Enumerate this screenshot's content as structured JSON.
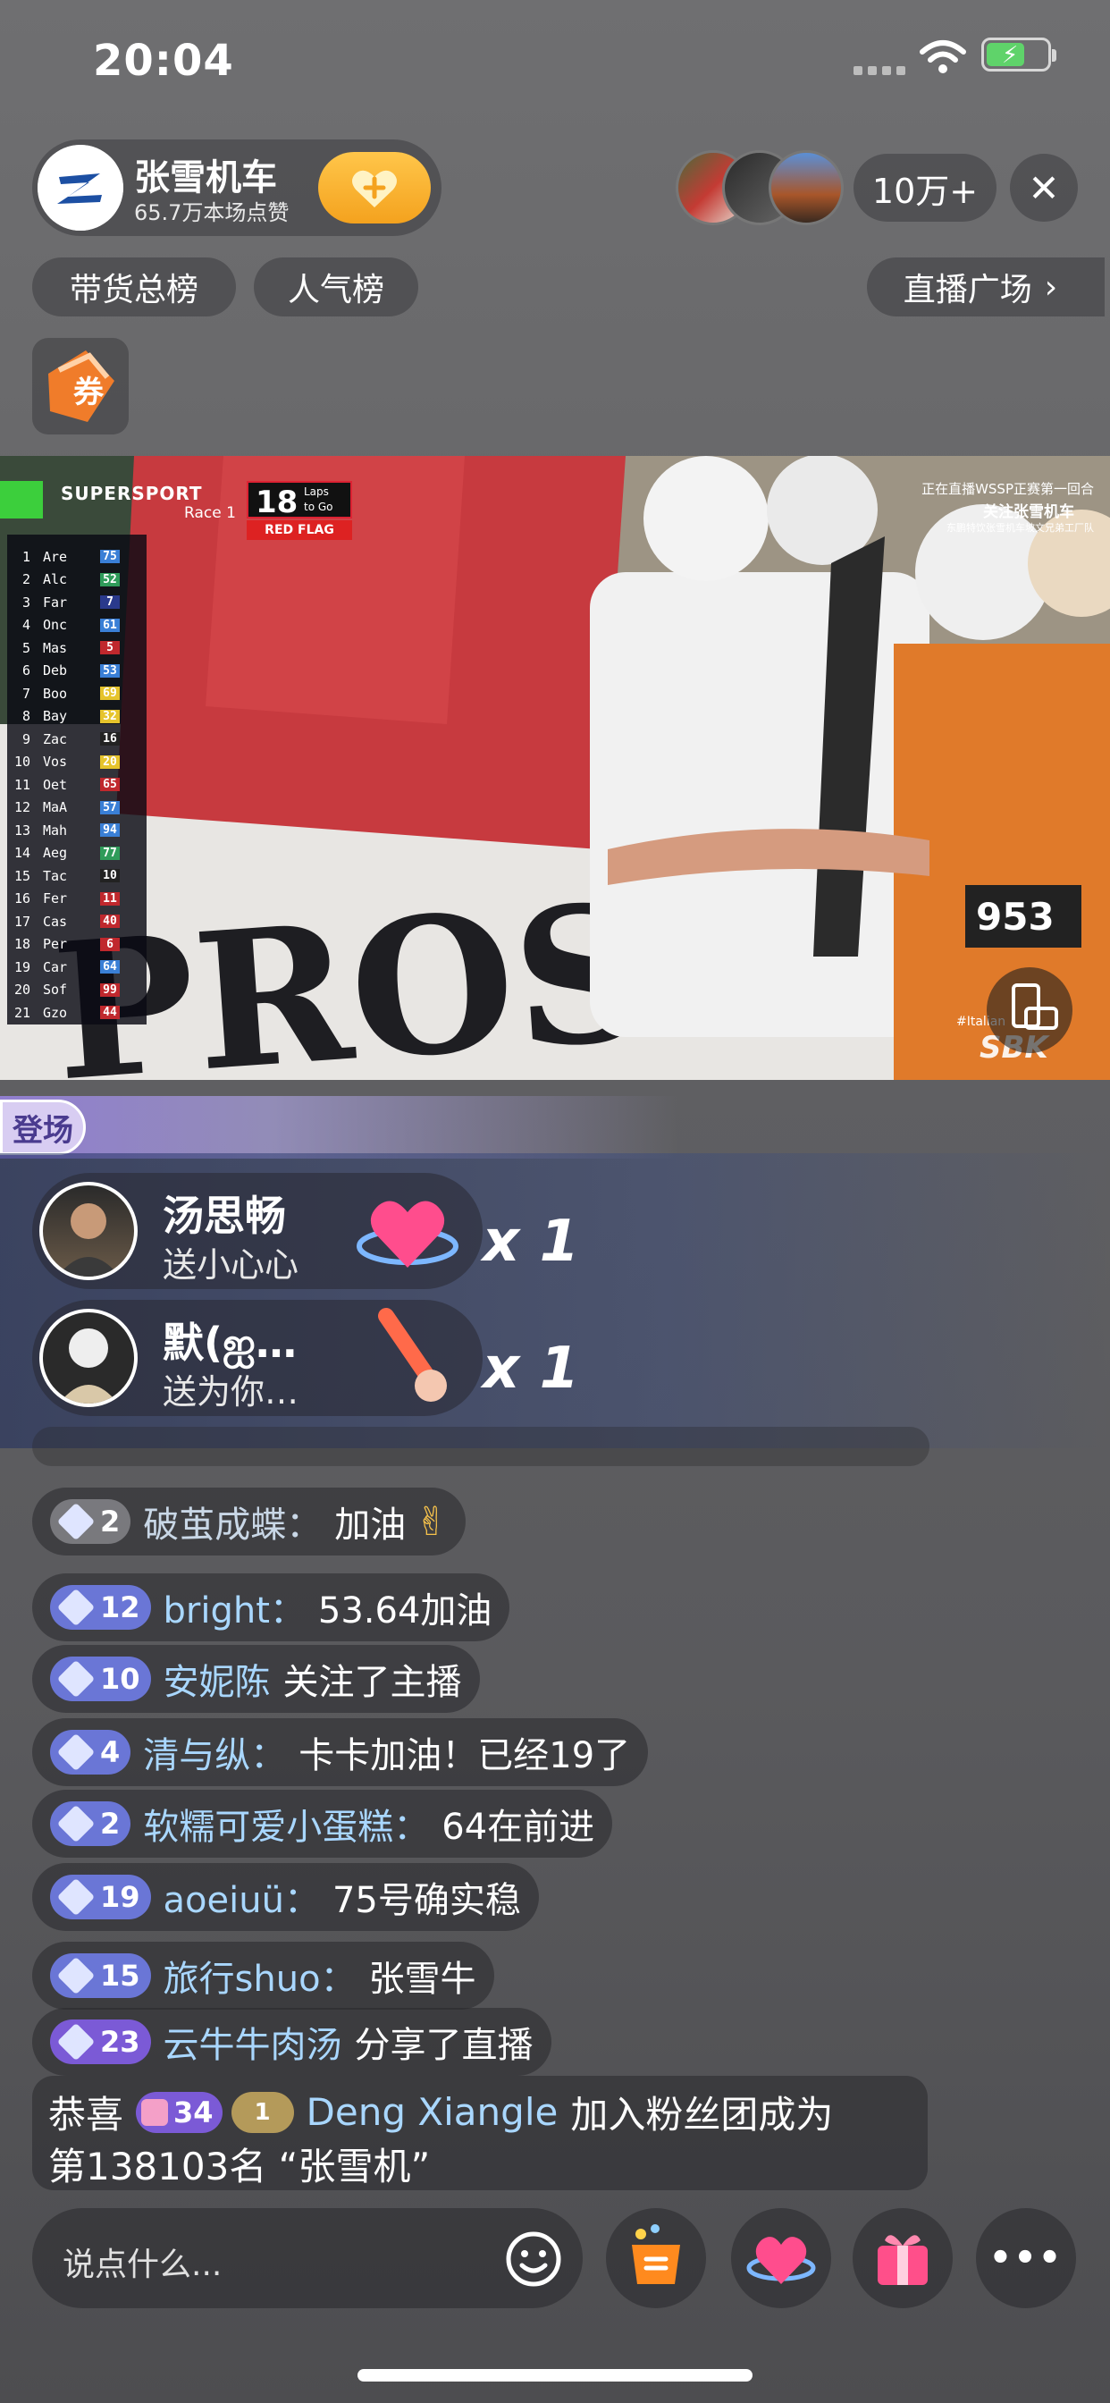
{
  "status": {
    "time": "20:04"
  },
  "host": {
    "name": "张雪机车",
    "likes": "65.7万本场点赞"
  },
  "viewers": {
    "count": "10万+"
  },
  "chips": {
    "left1": "带货总榜",
    "left2": "人气榜",
    "right": "直播广场"
  },
  "video": {
    "series": "SUPERSPORT",
    "race": "Race 1",
    "laps": "18",
    "laps_label1": "Laps",
    "laps_label2": "to Go",
    "flag": "RED FLAG",
    "overlay1": "正在直播WSSP正赛第一回合",
    "overlay2": "关注张雪机车",
    "overlay3": "东鹏特饮张雪机车坡文兄弟工厂队",
    "rows": [
      {
        "p": "1",
        "n": "Are",
        "no": "75",
        "c": "#3a7fd6"
      },
      {
        "p": "2",
        "n": "Alc",
        "no": "52",
        "c": "#2f9c5a"
      },
      {
        "p": "3",
        "n": "Far",
        "no": "7",
        "c": "#2a3a8c"
      },
      {
        "p": "4",
        "n": "Onc",
        "no": "61",
        "c": "#3a7fd6"
      },
      {
        "p": "5",
        "n": "Mas",
        "no": "5",
        "c": "#c0282d"
      },
      {
        "p": "6",
        "n": "Deb",
        "no": "53",
        "c": "#3a7fd6"
      },
      {
        "p": "7",
        "n": "Boo",
        "no": "69",
        "c": "#e6c42c"
      },
      {
        "p": "8",
        "n": "Bay",
        "no": "32",
        "c": "#e6c42c"
      },
      {
        "p": "9",
        "n": "Zac",
        "no": "16",
        "c": "#222"
      },
      {
        "p": "10",
        "n": "Vos",
        "no": "20",
        "c": "#e6c42c"
      },
      {
        "p": "11",
        "n": "Oet",
        "no": "65",
        "c": "#c0282d"
      },
      {
        "p": "12",
        "n": "MaA",
        "no": "57",
        "c": "#3a7fd6"
      },
      {
        "p": "13",
        "n": "Mah",
        "no": "94",
        "c": "#3a7fd6"
      },
      {
        "p": "14",
        "n": "Aeg",
        "no": "77",
        "c": "#2f9c5a"
      },
      {
        "p": "15",
        "n": "Tac",
        "no": "10",
        "c": "#222"
      },
      {
        "p": "16",
        "n": "Fer",
        "no": "11",
        "c": "#c0282d"
      },
      {
        "p": "17",
        "n": "Cas",
        "no": "40",
        "c": "#c0282d"
      },
      {
        "p": "18",
        "n": "Per",
        "no": "6",
        "c": "#c0282d"
      },
      {
        "p": "19",
        "n": "Car",
        "no": "64",
        "c": "#3a7fd6"
      },
      {
        "p": "20",
        "n": "Sof",
        "no": "99",
        "c": "#c0282d"
      },
      {
        "p": "21",
        "n": "Gzo",
        "no": "44",
        "c": "#c0282d"
      }
    ],
    "hashtag": "#Italian",
    "logo": "SBK"
  },
  "entry_banner": "登场",
  "gifts": [
    {
      "name": "汤思畅",
      "text": "送小心心",
      "count": "x 1"
    },
    {
      "name": "默(ஐ…",
      "text": "送为你…",
      "count": "x 1"
    }
  ],
  "comments": [
    {
      "level": "2",
      "user": "破茧成蝶：",
      "msg": "加油"
    },
    {
      "level": "12",
      "user": "bright：",
      "msg": "53.64加油"
    },
    {
      "level": "10",
      "user": "安妮陈",
      "msg": "关注了主播"
    },
    {
      "level": "4",
      "user": "清与纵：",
      "msg": "卡卡加油！已经19了"
    },
    {
      "level": "2",
      "user": "软糯可爱小蛋糕：",
      "msg": "64在前进"
    },
    {
      "level": "19",
      "user": "aoeiuü：",
      "msg": "75号确实稳"
    },
    {
      "level": "15",
      "user": "旅行shuo：",
      "msg": "张雪牛"
    },
    {
      "level": "23",
      "user": "云牛牛肉汤",
      "msg": "分享了直播"
    }
  ],
  "fan_join": {
    "prefix": "恭喜",
    "level": "34",
    "badge": "1",
    "user": "Deng Xiangle",
    "text": "加入粉丝团成为",
    "line2": "第138103名 “张雪机”"
  },
  "input": {
    "placeholder": "说点什么..."
  },
  "colors": {
    "level_blue": "#6a76d6",
    "username": "#a9d7ff",
    "follow": "#f4a21e"
  }
}
